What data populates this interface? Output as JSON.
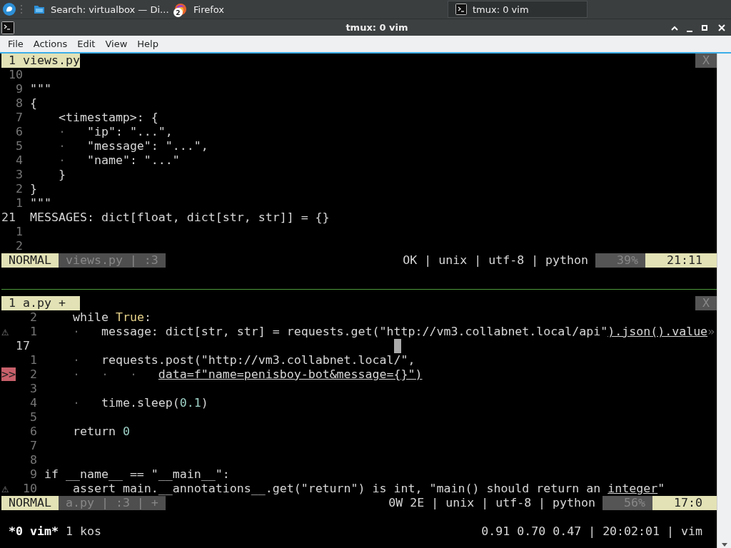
{
  "taskbar": {
    "tasks": [
      {
        "kind": "folder",
        "title": "Search: virtualbox — Di...",
        "selected": false
      },
      {
        "kind": "browser",
        "title": "Firefox",
        "badge": "2",
        "selected": false
      },
      {
        "kind": "terminal",
        "title": "tmux: 0 vim",
        "selected": true
      }
    ]
  },
  "window": {
    "title": "tmux: 0 vim"
  },
  "menu": [
    "File",
    "Actions",
    "Edit",
    "View",
    "Help"
  ],
  "panes": [
    {
      "tab": {
        "label": "1 views.py",
        "close": "X"
      },
      "lines": [
        {
          "number": "10",
          "current": false
        },
        {
          "number": "9",
          "current": false,
          "segments": [
            {
              "kind": "code",
              "text": "\"\"\""
            }
          ]
        },
        {
          "number": "8",
          "current": false,
          "segments": [
            {
              "kind": "code",
              "text": "{"
            }
          ]
        },
        {
          "number": "7",
          "current": false,
          "segments": [
            {
              "kind": "code",
              "text": "    <timestamp>: {"
            }
          ]
        },
        {
          "number": "6",
          "current": false,
          "segments": [
            {
              "kind": "guide",
              "text": "    ·   "
            },
            {
              "kind": "code",
              "text": "\"ip\": \"...\","
            }
          ]
        },
        {
          "number": "5",
          "current": false,
          "segments": [
            {
              "kind": "guide",
              "text": "    ·   "
            },
            {
              "kind": "code",
              "text": "\"message\": \"...\","
            }
          ]
        },
        {
          "number": "4",
          "current": false,
          "segments": [
            {
              "kind": "guide",
              "text": "    ·   "
            },
            {
              "kind": "code",
              "text": "\"name\": \"...\""
            }
          ]
        },
        {
          "number": "3",
          "current": false,
          "segments": [
            {
              "kind": "code",
              "text": "    }"
            }
          ]
        },
        {
          "number": "2",
          "current": false,
          "segments": [
            {
              "kind": "code",
              "text": "}"
            }
          ]
        },
        {
          "number": "1",
          "current": false,
          "segments": [
            {
              "kind": "code",
              "text": "\"\"\""
            }
          ]
        },
        {
          "number": "21",
          "current": true,
          "segments": [
            {
              "kind": "code",
              "text": "MESSAGES: dict[float, dict[str, str]] = {}"
            }
          ]
        },
        {
          "number": "1",
          "current": false
        },
        {
          "number": "2",
          "current": false
        }
      ],
      "status": {
        "mode": "NORMAL",
        "file": "views.py | :3",
        "info": "OK | unix | utf-8 | python",
        "percent": "39%",
        "position": "21:11"
      }
    },
    {
      "tab": {
        "label": "1 a.py +",
        "close": "X"
      },
      "lines": [
        {
          "number": "2",
          "current": false,
          "segments": [
            {
              "kind": "code",
              "text": "    while "
            },
            {
              "kind": "keyword",
              "text": "True"
            },
            {
              "kind": "code",
              "text": ":"
            }
          ]
        },
        {
          "number": "1",
          "current": false,
          "sign": {
            "kind": "warning",
            "text": "⚠"
          },
          "segments": [
            {
              "kind": "guide",
              "text": "    ·   "
            },
            {
              "kind": "code",
              "text": "message: dict[str, str] = requests.get(\"http://vm3.collabnet.local/api\""
            },
            {
              "kind": "underlined",
              "text": ").json().value"
            },
            {
              "kind": "guide",
              "text": "»"
            }
          ]
        },
        {
          "number": "17",
          "current": true,
          "cursor": true
        },
        {
          "number": "1",
          "current": false,
          "segments": [
            {
              "kind": "guide",
              "text": "    ·   "
            },
            {
              "kind": "code",
              "text": "requests.post(\"http://vm3.collabnet.local/\","
            }
          ]
        },
        {
          "number": "2",
          "current": false,
          "sign": {
            "kind": "error",
            "text": ">>"
          },
          "segments": [
            {
              "kind": "guide",
              "text": "    ·   ·   ·   "
            },
            {
              "kind": "underlined",
              "text": "data=f\"name=penisboy-bot&message={}\")"
            }
          ]
        },
        {
          "number": "3",
          "current": false
        },
        {
          "number": "4",
          "current": false,
          "segments": [
            {
              "kind": "guide",
              "text": "    ·   "
            },
            {
              "kind": "code",
              "text": "time.sleep("
            },
            {
              "kind": "number",
              "text": "0.1"
            },
            {
              "kind": "code",
              "text": ")"
            }
          ]
        },
        {
          "number": "5",
          "current": false
        },
        {
          "number": "6",
          "current": false,
          "segments": [
            {
              "kind": "code",
              "text": "    return "
            },
            {
              "kind": "number",
              "text": "0"
            }
          ]
        },
        {
          "number": "7",
          "current": false
        },
        {
          "number": "8",
          "current": false
        },
        {
          "number": "9",
          "current": false,
          "segments": [
            {
              "kind": "code",
              "text": "if __name__ == \"__main__\":"
            }
          ]
        },
        {
          "number": "10",
          "current": false,
          "sign": {
            "kind": "warning",
            "text": "⚠"
          },
          "segments": [
            {
              "kind": "code",
              "text": "    assert main.__annotations__.get(\"return\") is int, \"main() should return an "
            },
            {
              "kind": "underlined",
              "text": "integer"
            },
            {
              "kind": "code",
              "text": "\""
            }
          ]
        }
      ],
      "status": {
        "mode": "NORMAL",
        "file": "a.py | :3 | +",
        "info": "0W 2E | unix | utf-8 | python",
        "percent": "56%",
        "position": "17:0"
      }
    }
  ],
  "tmux_status": {
    "windows": [
      {
        "label": "*0 vim*",
        "selected": true
      },
      {
        "label": "1 kos",
        "selected": false
      }
    ],
    "right": "0.91 0.70 0.47 | 20:02:01 | vim"
  }
}
